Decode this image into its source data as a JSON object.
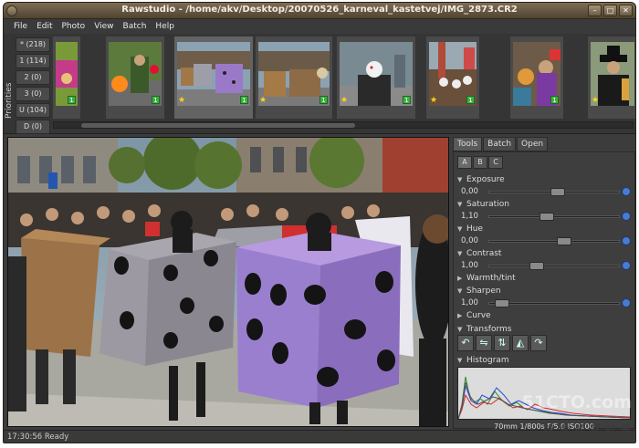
{
  "window": {
    "title": "Rawstudio - /home/akv/Desktop/20070526_karneval_kastetvej/IMG_2873.CR2"
  },
  "menu": [
    "File",
    "Edit",
    "Photo",
    "View",
    "Batch",
    "Help"
  ],
  "priorities": {
    "label": "Priorities",
    "items": [
      "* (218)",
      "1 (114)",
      "2 (0)",
      "3 (0)",
      "U (104)",
      "D (0)"
    ]
  },
  "thumbnails": [
    {
      "badge": "1",
      "star": false
    },
    {
      "badge": "1",
      "star": false
    },
    {
      "badge": "1",
      "star": true,
      "selected": true
    },
    {
      "badge": "1",
      "star": true
    },
    {
      "badge": "1",
      "star": true
    },
    {
      "badge": "1",
      "star": true
    },
    {
      "badge": "1",
      "star": false
    },
    {
      "badge": "1",
      "star": true
    }
  ],
  "panel": {
    "tabs": [
      "Tools",
      "Batch",
      "Open"
    ],
    "snapshots": [
      "A",
      "B",
      "C"
    ],
    "exposure": {
      "label": "Exposure",
      "value": "0,00",
      "pos": 0.52
    },
    "saturation": {
      "label": "Saturation",
      "value": "1,10",
      "pos": 0.43
    },
    "hue": {
      "label": "Hue",
      "value": "0,00",
      "pos": 0.58
    },
    "contrast": {
      "label": "Contrast",
      "value": "1,00",
      "pos": 0.34
    },
    "warmth": {
      "label": "Warmth/tint"
    },
    "sharpen": {
      "label": "Sharpen",
      "value": "1,00",
      "pos": 0.05
    },
    "curve": {
      "label": "Curve"
    },
    "transforms": {
      "label": "Transforms"
    },
    "histogram": {
      "label": "Histogram",
      "caption": "70mm 1/800s F/5.0 ISO100"
    }
  },
  "status": "17:30:56 Ready",
  "watermark": {
    "site": "51CTO.com",
    "slogan": "技 术 成 就 梦 想"
  }
}
